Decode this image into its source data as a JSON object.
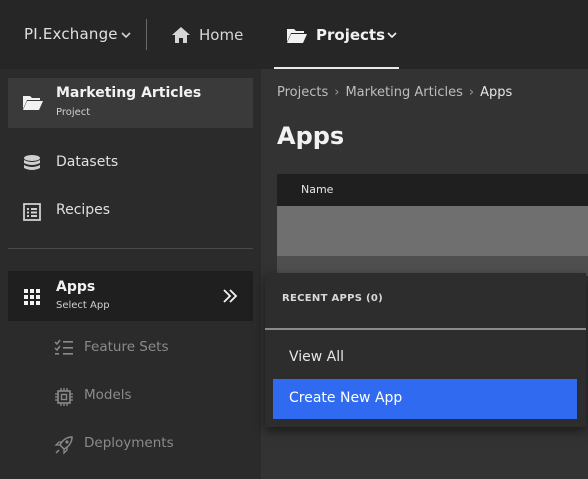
{
  "topbar": {
    "brand": "PI.Exchange",
    "home_label": "Home",
    "projects_label": "Projects"
  },
  "sidebar": {
    "project": {
      "title": "Marketing Articles",
      "subtitle": "Project"
    },
    "items": [
      {
        "label": "Datasets",
        "icon": "database-icon"
      },
      {
        "label": "Recipes",
        "icon": "recipe-list-icon"
      }
    ],
    "apps": {
      "title": "Apps",
      "subtitle": "Select App"
    },
    "subitems": [
      {
        "label": "Feature Sets",
        "icon": "checklist-icon"
      },
      {
        "label": "Models",
        "icon": "chip-icon"
      },
      {
        "label": "Deployments",
        "icon": "rocket-icon"
      }
    ]
  },
  "breadcrumb": [
    "Projects",
    "Marketing Articles",
    "Apps"
  ],
  "page_title": "Apps",
  "table": {
    "header_name": "Name"
  },
  "dropdown": {
    "recent_header": "RECENT APPS (0)",
    "view_all": "View All",
    "create_new": "Create New App"
  },
  "colors": {
    "accent": "#2f6af0",
    "topbar_bg": "#262626",
    "sidebar_bg": "#2b2b2b",
    "main_bg": "#333333"
  }
}
